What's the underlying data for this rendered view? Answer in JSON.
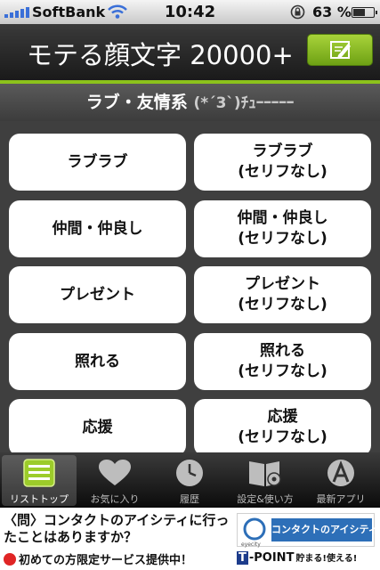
{
  "status_bar": {
    "carrier": "SoftBank",
    "time": "10:42",
    "battery_percent": "63 %",
    "battery_level": 0.63
  },
  "header": {
    "title": "モテる顔文字 20000+",
    "edit_icon": "memo-pencil-icon"
  },
  "section": {
    "title": "ラブ・友情系",
    "emoticon": "(*´3`)ﾁｭｰｰｰｰｰ"
  },
  "categories": [
    "ラブラブ",
    "ラブラブ\n(セリフなし)",
    "仲間・仲良し",
    "仲間・仲良し\n(セリフなし)",
    "プレゼント",
    "プレゼント\n(セリフなし)",
    "照れる",
    "照れる\n(セリフなし)",
    "応援",
    "応援\n(セリフなし)"
  ],
  "tabs": [
    {
      "label": "リストトップ",
      "icon": "list-icon",
      "active": true
    },
    {
      "label": "お気に入り",
      "icon": "heart-icon",
      "active": false
    },
    {
      "label": "履歴",
      "icon": "clock-icon",
      "active": false
    },
    {
      "label": "設定&使い方",
      "icon": "book-gear-icon",
      "active": false
    },
    {
      "label": "最新アプリ",
      "icon": "app-store-icon",
      "active": false
    }
  ],
  "ad": {
    "question": "〈問〉コンタクトのアイシティに行ったことはありますか？",
    "offer": "初めての方限定サービス提供中！",
    "brand_small": "eyecity",
    "brand_name": "コンタクトのアイシティ",
    "tpoint_mark": "T",
    "tpoint_label": "-POINT",
    "tpoint_slogan": "貯まる!使える!"
  },
  "colors": {
    "accent_green": "#8cc21c",
    "signal_blue": "#3a6fd8"
  }
}
